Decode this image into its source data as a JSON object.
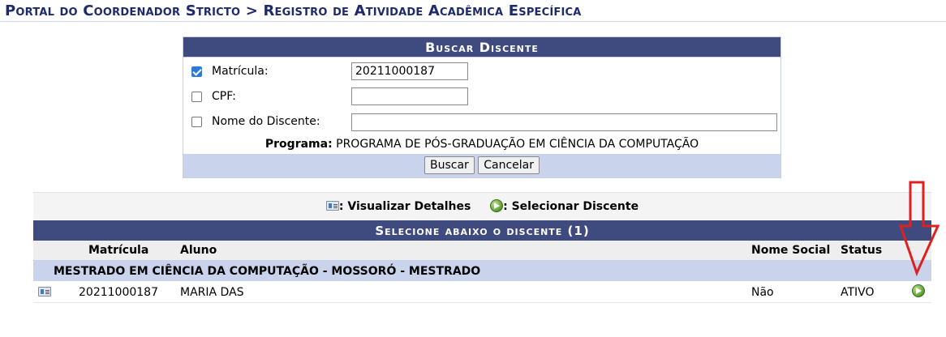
{
  "breadcrumb": "Portal do Coordenador Stricto > Registro de Atividade Acadêmica Específica",
  "search": {
    "title": "Buscar Discente",
    "matricula": {
      "label": "Matrícula:",
      "checked": true,
      "value": "20211000187"
    },
    "cpf": {
      "label": "CPF:",
      "checked": false,
      "value": ""
    },
    "nome": {
      "label": "Nome do Discente:",
      "checked": false,
      "value": ""
    },
    "programa_label": "Programa:",
    "programa_value": "PROGRAMA DE PÓS-GRADUAÇÃO EM CIÊNCIA DA COMPUTAÇÃO",
    "buscar_label": "Buscar",
    "cancelar_label": "Cancelar"
  },
  "legend": {
    "detalhes_icon": "student-card-icon",
    "detalhes_label": ": Visualizar Detalhes",
    "selecionar_icon": "green-arrow-icon",
    "selecionar_label": ": Selecionar Discente"
  },
  "results": {
    "title": "Selecione abaixo o discente (1)",
    "columns": {
      "matricula": "Matrícula",
      "aluno": "Aluno",
      "nome_social": "Nome Social",
      "status": "Status"
    },
    "group": "MESTRADO EM CIÊNCIA DA COMPUTAÇÃO - MOSSORÓ - MESTRADO",
    "rows": [
      {
        "matricula": "20211000187",
        "aluno": "MARIA DAS",
        "nome_social": "Não",
        "status": "ATIVO"
      }
    ]
  },
  "colors": {
    "header": "#3f4a7f",
    "band": "#c9d3ec",
    "annotation": "#e02020"
  }
}
